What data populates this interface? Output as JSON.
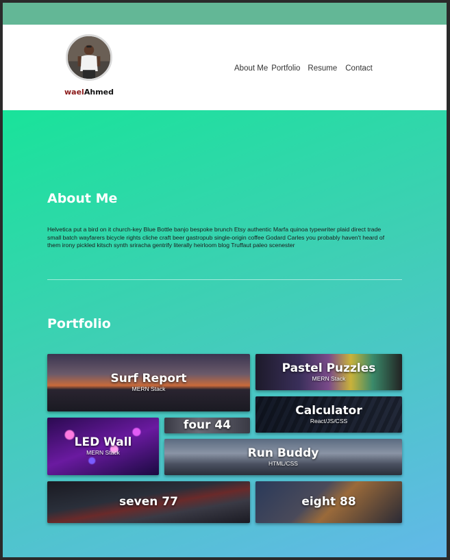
{
  "brand": {
    "first": "wael",
    "last": "Ahmed"
  },
  "nav": {
    "about": "About Me",
    "portfolio": "Portfolio",
    "resume": "Resume",
    "contact": "Contact"
  },
  "about": {
    "title": "About Me",
    "text": "Helvetica put a bird on it church-key Blue Bottle banjo bespoke brunch Etsy authentic Marfa quinoa typewriter plaid direct trade small batch wayfarers bicycle rights cliche craft beer gastropub single-origin coffee Godard Carles you probably haven't heard of them irony pickled kitsch synth sriracha gentrify literally heirloom blog Truffaut paleo scenester"
  },
  "portfolio": {
    "title": "Portfolio",
    "items": [
      {
        "title": "Surf Report",
        "sub": "MERN Stack"
      },
      {
        "title": "Pastel Puzzles",
        "sub": "MERN Stack"
      },
      {
        "title": "Calculator",
        "sub": "React/JS/CSS"
      },
      {
        "title": "LED Wall",
        "sub": "MERN Stack"
      },
      {
        "title": "four 44",
        "sub": ""
      },
      {
        "title": "Run Buddy",
        "sub": "HTML/CSS"
      },
      {
        "title": "seven 77",
        "sub": ""
      },
      {
        "title": "eight 88",
        "sub": ""
      }
    ]
  },
  "colors": {
    "top_strip": "#63b796",
    "gradient_start": "#19e39a",
    "gradient_end": "#62b8e8",
    "brand_first": "#8b1a1a"
  }
}
